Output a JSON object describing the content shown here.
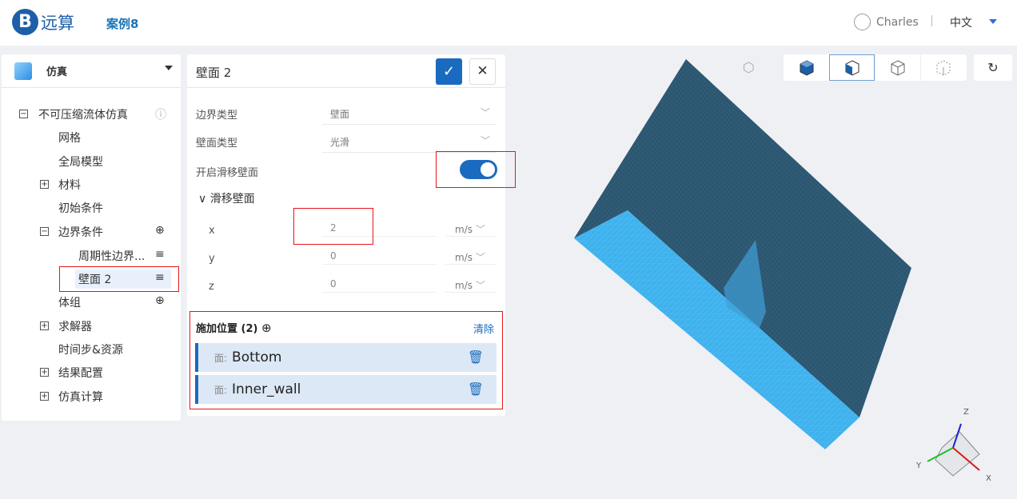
{
  "header": {
    "logo_text": "远算",
    "case_title": "案例8",
    "user_name": "Charles",
    "language": "中文"
  },
  "left_panel": {
    "title": "仿真",
    "tree": [
      {
        "label": "不可压缩流体仿真",
        "expander": "minus",
        "action": "info"
      },
      {
        "label": "网格"
      },
      {
        "label": "全局模型"
      },
      {
        "label": "材料",
        "expander": "plus"
      },
      {
        "label": "初始条件"
      },
      {
        "label": "边界条件",
        "expander": "minus",
        "action": "add"
      },
      {
        "label": "周期性边界...",
        "action": "menu"
      },
      {
        "label": "壁面 2",
        "action": "menu",
        "selected": true
      },
      {
        "label": "体组",
        "action": "add"
      },
      {
        "label": "求解器",
        "expander": "plus"
      },
      {
        "label": "时间步&资源"
      },
      {
        "label": "结果配置",
        "expander": "plus"
      },
      {
        "label": "仿真计算",
        "expander": "plus"
      }
    ]
  },
  "form": {
    "title": "壁面 2",
    "boundary_type_label": "边界类型",
    "boundary_type_value": "壁面",
    "wall_type_label": "壁面类型",
    "wall_type_value": "光滑",
    "slip_toggle_label": "开启滑移壁面",
    "slip_toggle_on": true,
    "slip_section": "滑移壁面",
    "velocity": [
      {
        "axis": "x",
        "value": "2",
        "unit": "m/s"
      },
      {
        "axis": "y",
        "value": "0",
        "unit": "m/s"
      },
      {
        "axis": "z",
        "value": "0",
        "unit": "m/s"
      }
    ],
    "apply_label": "施加位置 (2)",
    "clear_label": "清除",
    "faces": [
      {
        "prefix": "面:",
        "name": "Bottom"
      },
      {
        "prefix": "面:",
        "name": "Inner_wall"
      }
    ]
  },
  "viewer": {
    "axes": {
      "x": "X",
      "y": "Y",
      "z": "Z"
    },
    "colors": {
      "mesh_dark": "#2c5670",
      "mesh_light": "#3fb2ee",
      "accent": "#1a6bbf"
    }
  }
}
